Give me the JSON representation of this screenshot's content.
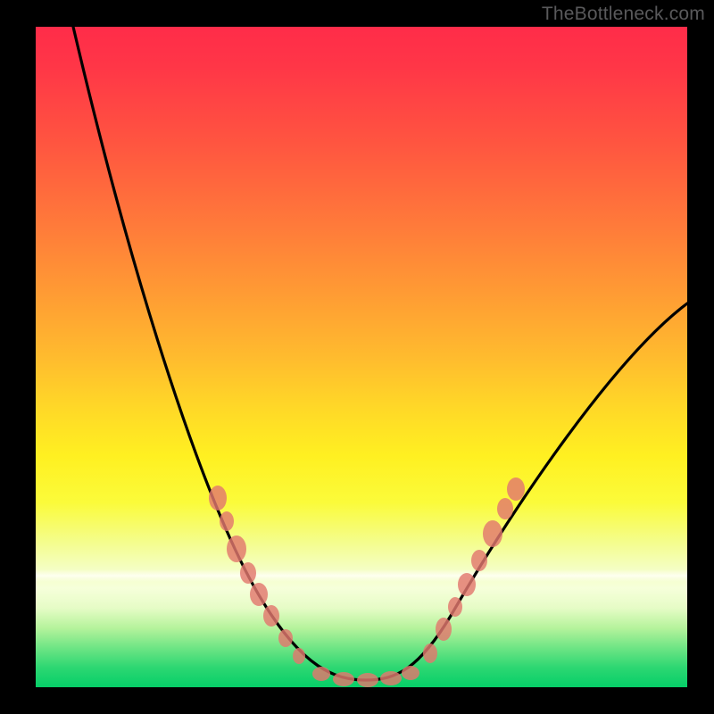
{
  "watermark": "TheBottleneck.com",
  "chart_data": {
    "type": "line",
    "title": "",
    "xlabel": "",
    "ylabel": "",
    "xlim": [
      0,
      100
    ],
    "ylim": [
      0,
      100
    ],
    "grid": false,
    "legend": false,
    "series": [
      {
        "name": "bottleneck-curve",
        "x": [
          6,
          12,
          20,
          28,
          35,
          40,
          45,
          50,
          55,
          60,
          65,
          72,
          80,
          90,
          100
        ],
        "y": [
          100,
          82,
          60,
          42,
          28,
          18,
          8,
          1,
          1,
          6,
          16,
          30,
          44,
          54,
          58
        ]
      }
    ],
    "markers": {
      "name": "highlighted-points",
      "color": "#e2786e",
      "x": [
        28,
        29,
        31,
        33,
        34,
        36,
        38,
        40,
        44,
        47,
        51,
        55,
        58,
        61,
        63,
        64,
        66,
        68,
        70,
        72,
        74
      ],
      "y": [
        29,
        25,
        21,
        17,
        14,
        11,
        8,
        5,
        2,
        1,
        1,
        1,
        2,
        5,
        9,
        12,
        16,
        19,
        23,
        27,
        30
      ]
    },
    "background_gradient_stops": [
      {
        "pos": 0,
        "color": "#ff2c49"
      },
      {
        "pos": 30,
        "color": "#ff7a3a"
      },
      {
        "pos": 58,
        "color": "#ffd927"
      },
      {
        "pos": 82,
        "color": "#f4fec2"
      },
      {
        "pos": 100,
        "color": "#06cf68"
      }
    ]
  }
}
